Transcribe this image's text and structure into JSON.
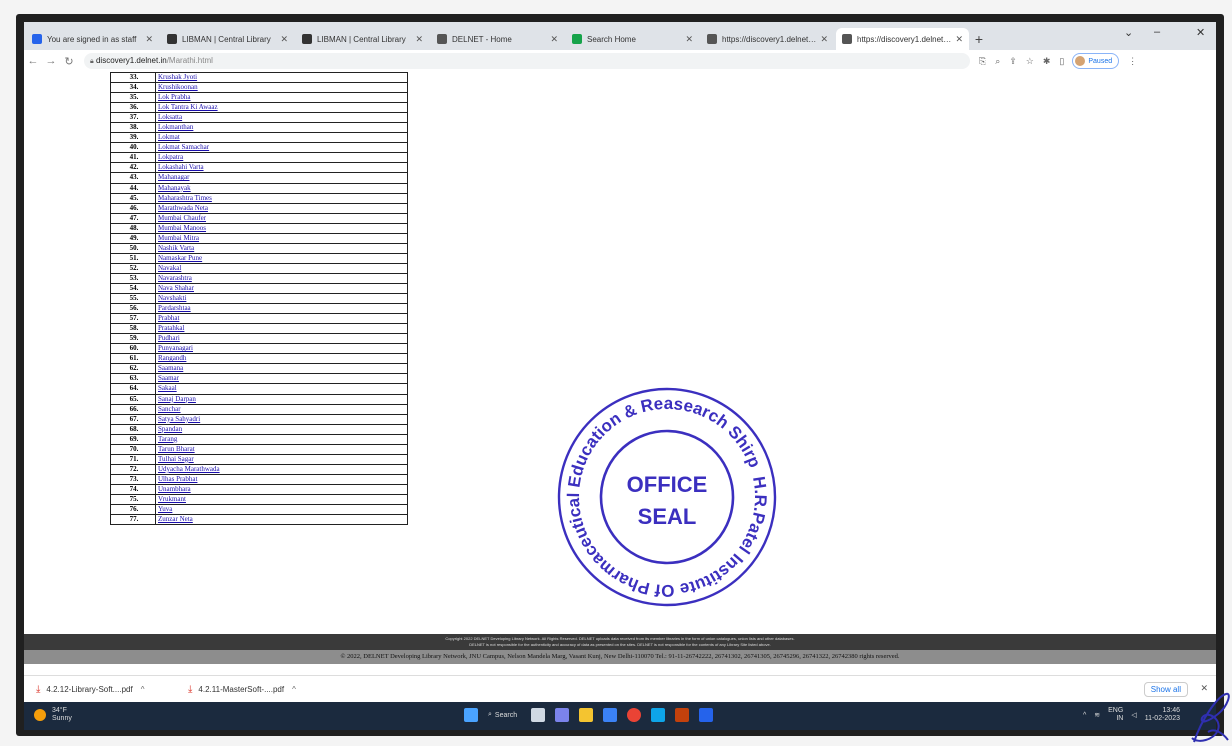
{
  "browser": {
    "tabs": [
      {
        "title": "You are signed in as staff",
        "icon_color": "#2563eb",
        "active": false
      },
      {
        "title": "LIBMAN | Central Library",
        "icon_color": "#333333",
        "active": false
      },
      {
        "title": "LIBMAN | Central Library",
        "icon_color": "#333333",
        "active": false
      },
      {
        "title": "DELNET - Home",
        "icon_color": "#555555",
        "active": false
      },
      {
        "title": "Search Home",
        "icon_color": "#16a34a",
        "active": false
      },
      {
        "title": "https://discovery1.delnet.in/en",
        "icon_color": "#555555",
        "active": false
      },
      {
        "title": "https://discovery1.delnet.in/Ma",
        "icon_color": "#555555",
        "active": true
      }
    ],
    "url_host": "discovery1.delnet.in",
    "url_path": "/Marathi.html",
    "profile_label": "Paused"
  },
  "newspapers": [
    {
      "num": "33.",
      "name": "Krushak Jyoti"
    },
    {
      "num": "34.",
      "name": "Krushikoonan"
    },
    {
      "num": "35.",
      "name": "Lok Prabha"
    },
    {
      "num": "36.",
      "name": "Lok Tantra Ki Awaaz"
    },
    {
      "num": "37.",
      "name": "Loksatta"
    },
    {
      "num": "38.",
      "name": "Lokmanthan"
    },
    {
      "num": "39.",
      "name": "Lokmat"
    },
    {
      "num": "40.",
      "name": "Lokmat Samachar"
    },
    {
      "num": "41.",
      "name": "Lokpatra"
    },
    {
      "num": "42.",
      "name": "Lokashahi Varta"
    },
    {
      "num": "43.",
      "name": "Mahanagar"
    },
    {
      "num": "44.",
      "name": "Mahanayak"
    },
    {
      "num": "45.",
      "name": "Maharashtra Times"
    },
    {
      "num": "46.",
      "name": "Marathwada Neta"
    },
    {
      "num": "47.",
      "name": "Mumbai Chaufer"
    },
    {
      "num": "48.",
      "name": "Mumbai Manoos"
    },
    {
      "num": "49.",
      "name": "Mumbai Mitra"
    },
    {
      "num": "50.",
      "name": "Nashik Varta"
    },
    {
      "num": "51.",
      "name": "Namaskar Pune"
    },
    {
      "num": "52.",
      "name": "Navakal"
    },
    {
      "num": "53.",
      "name": "Navarashtra"
    },
    {
      "num": "54.",
      "name": "Nava Shahar"
    },
    {
      "num": "55.",
      "name": "Navshakti"
    },
    {
      "num": "56.",
      "name": "Pardarshtaa"
    },
    {
      "num": "57.",
      "name": "Prabhat"
    },
    {
      "num": "58.",
      "name": "Pratahkal"
    },
    {
      "num": "59.",
      "name": "Pudhari"
    },
    {
      "num": "60.",
      "name": "Punyanagari"
    },
    {
      "num": "61.",
      "name": "Rangandh"
    },
    {
      "num": "62.",
      "name": "Saamana"
    },
    {
      "num": "63.",
      "name": "Saamar"
    },
    {
      "num": "64.",
      "name": "Sakaal"
    },
    {
      "num": "65.",
      "name": "Sanaj Darpan"
    },
    {
      "num": "66.",
      "name": "Sanchar"
    },
    {
      "num": "67.",
      "name": "Satya Sahyadri"
    },
    {
      "num": "68.",
      "name": "Spandan"
    },
    {
      "num": "69.",
      "name": "Tarang"
    },
    {
      "num": "70.",
      "name": "Tarun Bharat"
    },
    {
      "num": "71.",
      "name": "Tulhai Sagar"
    },
    {
      "num": "72.",
      "name": "Udyacha Marathwada"
    },
    {
      "num": "73.",
      "name": "Ulhas Prabhat"
    },
    {
      "num": "74.",
      "name": "Unambhara"
    },
    {
      "num": "75.",
      "name": "Vrukmant"
    },
    {
      "num": "76.",
      "name": "Yuva"
    },
    {
      "num": "77.",
      "name": "Zunzar Neta"
    }
  ],
  "footer": {
    "copyright_line": "Copyright 2022 DELNET Developing Library Network. All Rights Reserved. DELNET uploads data received from its member libraries in the form of union catalogues, union lists and other databases.",
    "disclaimer_line": "DELNET is not responsible for the authenticity and accuracy of data as presented on the sites. DELNET is not responsible for the contents of any Library Site listed above.",
    "address": "© 2022, DELNET Developing Library Network, JNU Campus, Nelson Mandela Marg, Vasant Kunj, New Delhi-110070 Tel.: 91-11-26742222, 26741302, 26741305, 26745296, 26741322, 26742380 rights reserved."
  },
  "downloads": {
    "items": [
      "4.2.12-Library-Soft....pdf",
      "4.2.11-MasterSoft-....pdf"
    ],
    "show_all": "Show all"
  },
  "taskbar": {
    "temperature": "34°F",
    "condition": "Sunny",
    "search_label": "Search",
    "lang_top": "ENG",
    "lang_bottom": "IN",
    "time": "13:46",
    "date": "11-02-2023"
  },
  "seal": {
    "ring_text": "H.R.Patel Institute Of Pharmaceutical Education & Reasearch Shirpur ★",
    "center_line1": "OFFICE",
    "center_line2": "SEAL",
    "ink_color": "#3b2fbf"
  }
}
